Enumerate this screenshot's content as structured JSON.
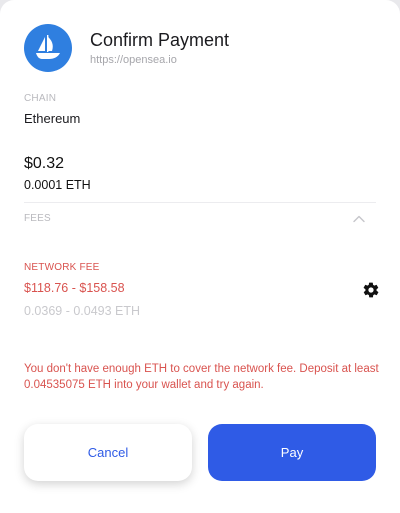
{
  "header": {
    "title": "Confirm Payment",
    "origin": "https://opensea.io",
    "logo_icon": "opensea-sailboat-icon",
    "logo_color": "#2f7fe0"
  },
  "chain": {
    "label": "CHAIN",
    "value": "Ethereum"
  },
  "amount": {
    "usd": "$0.32",
    "eth": "0.0001 ETH"
  },
  "fees": {
    "label": "FEES",
    "toggle_icon": "chevron-up-icon"
  },
  "network_fee": {
    "label": "NETWORK FEE",
    "usd_range": "$118.76 - $158.58",
    "eth_range": "0.0369 - 0.0493 ETH",
    "settings_icon": "gear-icon"
  },
  "error": {
    "message": "You don't have enough ETH to cover the network fee. Deposit at least 0.04535075 ETH into your wallet and try again."
  },
  "actions": {
    "cancel_label": "Cancel",
    "pay_label": "Pay"
  },
  "colors": {
    "accent": "#2f5be6",
    "error": "#d9534f",
    "muted": "#b9b9be"
  }
}
